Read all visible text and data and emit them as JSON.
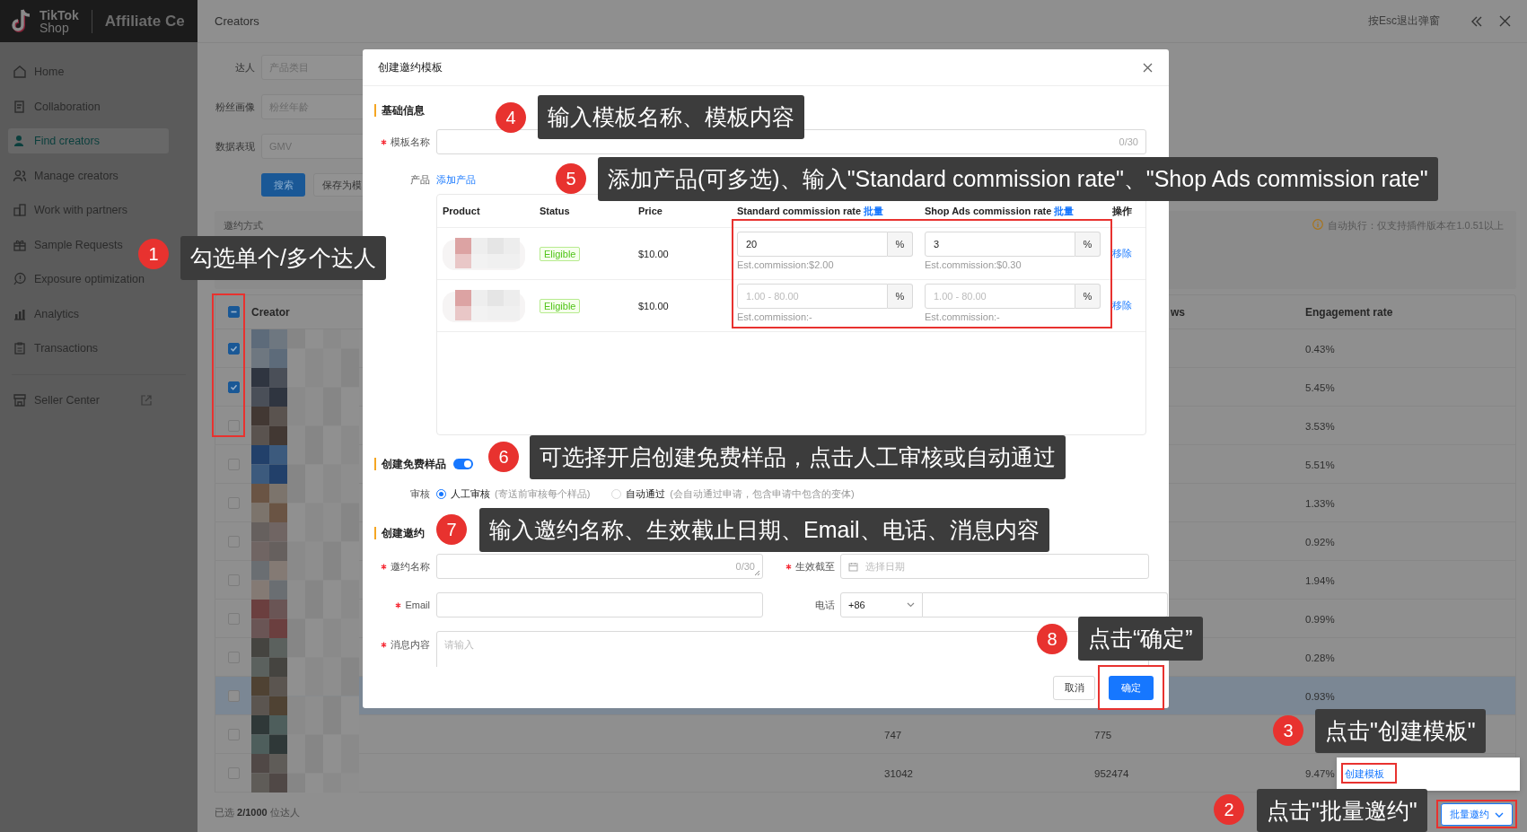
{
  "sidebar": {
    "brand_top": "TikTok",
    "brand_bottom": "Shop",
    "app_title": "Affiliate Ce",
    "items": [
      {
        "label": "Home",
        "selected": false
      },
      {
        "label": "Collaboration",
        "selected": false
      },
      {
        "label": "Find creators",
        "selected": true
      },
      {
        "label": "Manage creators",
        "selected": false
      },
      {
        "label": "Work with partners",
        "selected": false
      },
      {
        "label": "Sample Requests",
        "selected": false
      },
      {
        "label": "Exposure optimization",
        "selected": false
      },
      {
        "label": "Analytics",
        "selected": false
      },
      {
        "label": "Transactions",
        "selected": false
      }
    ],
    "footer_item": "Seller Center"
  },
  "page": {
    "title": "Creators",
    "esc_hint": "按Esc退出弹窗"
  },
  "filters": [
    {
      "label": "达人",
      "placeholder": "产品类目"
    },
    {
      "label": "粉丝画像",
      "placeholder": "粉丝年龄"
    },
    {
      "label": "数据表现",
      "placeholder": "GMV"
    }
  ],
  "filter_buttons": [
    {
      "label": "搜索",
      "kind": "primary"
    },
    {
      "label": "保存为模",
      "kind": "default"
    }
  ],
  "invite_panel": {
    "label": "邀约方式",
    "notice": "自动执行：仅支持插件版本在1.0.51以上"
  },
  "table": {
    "select_all_partial": true,
    "header": {
      "creator": "Creator",
      "column_4": "ws",
      "engagement": "Engagement rate"
    },
    "rows": [
      {
        "checked": true,
        "hovered": false,
        "engagement": "0.43%"
      },
      {
        "checked": true,
        "hovered": false,
        "engagement": "5.45%"
      },
      {
        "checked": false,
        "hovered": false,
        "engagement": "3.53%"
      },
      {
        "checked": false,
        "hovered": false,
        "engagement": "5.51%"
      },
      {
        "checked": false,
        "hovered": false,
        "engagement": "1.33%"
      },
      {
        "checked": false,
        "hovered": false,
        "engagement": "0.92%"
      },
      {
        "checked": false,
        "hovered": false,
        "engagement": "1.94%"
      },
      {
        "checked": false,
        "hovered": false,
        "engagement": "0.99%"
      },
      {
        "checked": false,
        "hovered": false,
        "engagement": "0.28%"
      },
      {
        "checked": false,
        "hovered": true,
        "engagement": "0.93%"
      },
      {
        "checked": false,
        "hovered": false,
        "column_3": "747",
        "column_4": "775"
      },
      {
        "checked": false,
        "hovered": false,
        "column_3": "31042",
        "column_4": "952474",
        "engagement": "9.47%"
      }
    ]
  },
  "selection_summary": "已选 **2/1000** 位达人",
  "bulk_button": "批量邀约",
  "bulk_menu": [
    {
      "label": "创建模板"
    }
  ],
  "modal": {
    "title": "创建邀约模板",
    "basic": {
      "heading": "基础信息",
      "name_label": "模板名称",
      "name_counter": "0/30",
      "product_label": "产品",
      "add_product": "添加产品",
      "columns": [
        {
          "label": "Product"
        },
        {
          "label": "Status"
        },
        {
          "label": "Price"
        },
        {
          "label": "Standard commission rate",
          "action": "批量"
        },
        {
          "label": "Shop Ads commission rate",
          "action": "批量"
        },
        {
          "label": "操作"
        }
      ],
      "products": [
        {
          "status": "Eligible",
          "price": "$10.00",
          "standard": {
            "value": "20",
            "unit": "%",
            "estimate": "Est.commission:$2.00"
          },
          "shop_ads": {
            "value": "3",
            "unit": "%",
            "estimate": "Est.commission:$0.30"
          },
          "remove": "移除"
        },
        {
          "status": "Eligible",
          "price": "$10.00",
          "standard": {
            "placeholder": "1.00 - 80.00",
            "unit": "%",
            "estimate": "Est.commission:-"
          },
          "shop_ads": {
            "placeholder": "1.00 - 80.00",
            "unit": "%",
            "estimate": "Est.commission:-"
          },
          "remove": "移除"
        }
      ]
    },
    "sample": {
      "heading": "创建免费样品",
      "on": true,
      "review_label": "审核",
      "options": [
        {
          "label": "人工审核",
          "note": "(寄送前审核每个样品)",
          "selected": true
        },
        {
          "label": "自动通过",
          "note": "(会自动通过申请，包含申请中包含的变体)",
          "selected": false
        }
      ]
    },
    "invite": {
      "heading": "创建邀约",
      "name": {
        "label": "邀约名称",
        "required": true,
        "counter": "0/30"
      },
      "deadline": {
        "label": "生效截至",
        "required": true,
        "placeholder": "选择日期"
      },
      "email": {
        "label": "Email",
        "required": true
      },
      "phone": {
        "label": "电话",
        "required": false,
        "code": "+86"
      },
      "message": {
        "label": "消息内容",
        "required": true,
        "placeholder": "请输入"
      }
    },
    "buttons": [
      {
        "label": "取消",
        "kind": "default"
      },
      {
        "label": "确定",
        "kind": "primary"
      }
    ]
  },
  "callouts": [
    {
      "number": "1",
      "text": "勾选单个/多个达人"
    },
    {
      "number": "2",
      "text": "点击\"批量邀约\""
    },
    {
      "number": "3",
      "text": "点击\"创建模板\""
    },
    {
      "number": "4",
      "text": "输入模板名称、模板内容"
    },
    {
      "number": "5",
      "text": "添加产品(可多选)、输入\"Standard commission rate\"、\"Shop Ads commission rate\""
    },
    {
      "number": "6",
      "text": "可选择开启创建免费样品，点击人工审核或自动通过"
    },
    {
      "number": "7",
      "text": "输入邀约名称、生效截止日期、Email、电话、消息内容"
    },
    {
      "number": "8",
      "text": "点击“确定”"
    }
  ]
}
